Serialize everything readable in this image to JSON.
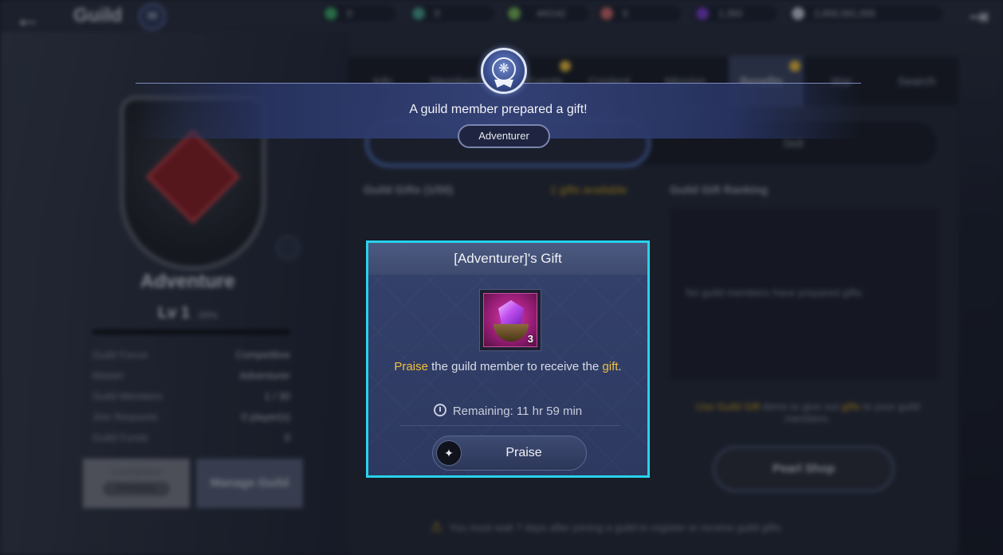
{
  "header": {
    "title": "Guild",
    "currencies": [
      {
        "icon": "green-gem-icon",
        "value": "0",
        "color": "#3fae6b"
      },
      {
        "icon": "teal-gem-icon",
        "value": "0",
        "color": "#4aa38f"
      },
      {
        "icon": "stamina-icon",
        "value": "44/142",
        "color": "#7bbd5a"
      },
      {
        "icon": "ruby-icon",
        "value": "0",
        "color": "#d26c6c"
      },
      {
        "icon": "purple-gem-icon",
        "value": "1,350",
        "color": "#7b3fd0"
      },
      {
        "icon": "silver-coin-icon",
        "value": "2,656,581,005",
        "color": "#c8d2e2"
      }
    ]
  },
  "tabs": [
    "Info",
    "Members",
    "Events",
    "Content",
    "Mission",
    "Benefits",
    "War",
    "Search"
  ],
  "subtabs": [
    "Adventurer",
    "Skill"
  ],
  "guild": {
    "name": "Adventure",
    "level": "Lv 1",
    "level_pct": ".00%",
    "info": [
      {
        "label": "Guild Focus",
        "value": "Competitive"
      },
      {
        "label": "Master",
        "value": "Adventurer"
      },
      {
        "label": "Guild Members",
        "value": "1 / 30"
      },
      {
        "label": "Join Requests",
        "value": "0 player(s)"
      },
      {
        "label": "Guild Funds",
        "value": "0"
      }
    ],
    "compare_label": "Compare",
    "compare_sub": "Refreshing",
    "manage_label": "Manage Guild"
  },
  "gifts": {
    "section_title": "Guild Gifts (1/50)",
    "available": "1 gifts available",
    "ranking_title": "Guild Gift Ranking",
    "ranking_empty": "No guild members have prepared gifts.",
    "use_prefix": "Use Guild Gift",
    "use_middle": "items to give out",
    "use_highlight": "gifts",
    "use_suffix": "to your guild members.",
    "pearl_shop": "Pearl Shop",
    "warning": "You must wait 7 days after joining a guild to register or receive guild gifts."
  },
  "banner": {
    "message": "A guild member prepared a gift!",
    "member": "Adventurer"
  },
  "dialog": {
    "title": "[Adventurer]'s Gift",
    "item_qty": "3",
    "msg_praise": "Praise",
    "msg_part1": "the guild member to receive the",
    "msg_gift": "gift",
    "msg_end": ".",
    "remaining": "Remaining: 11 hr 59 min",
    "button": "Praise"
  },
  "colors": {
    "dialog_border": "#27d3ee",
    "highlight": "#f1c13b"
  }
}
